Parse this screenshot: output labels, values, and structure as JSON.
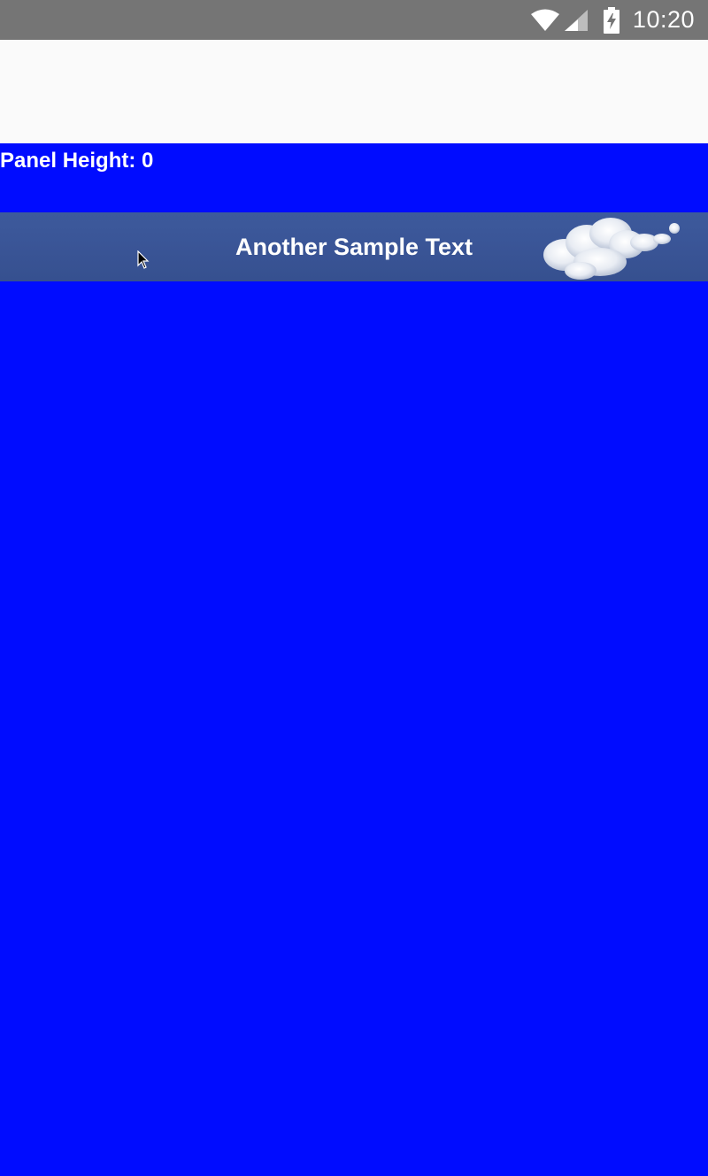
{
  "status_bar": {
    "time": "10:20",
    "icons": [
      "wifi-icon",
      "cell-signal-icon",
      "battery-charging-icon"
    ],
    "background": "#757575"
  },
  "app_bar": {
    "background": "#fafafa"
  },
  "panel": {
    "label": "Panel Height: 0",
    "background": "#000cff"
  },
  "banner": {
    "text": "Another Sample Text",
    "decoration": "cloud-image",
    "background": "#3a5597"
  },
  "colors": {
    "primary_blue": "#000cff",
    "text": "#ffffff"
  }
}
